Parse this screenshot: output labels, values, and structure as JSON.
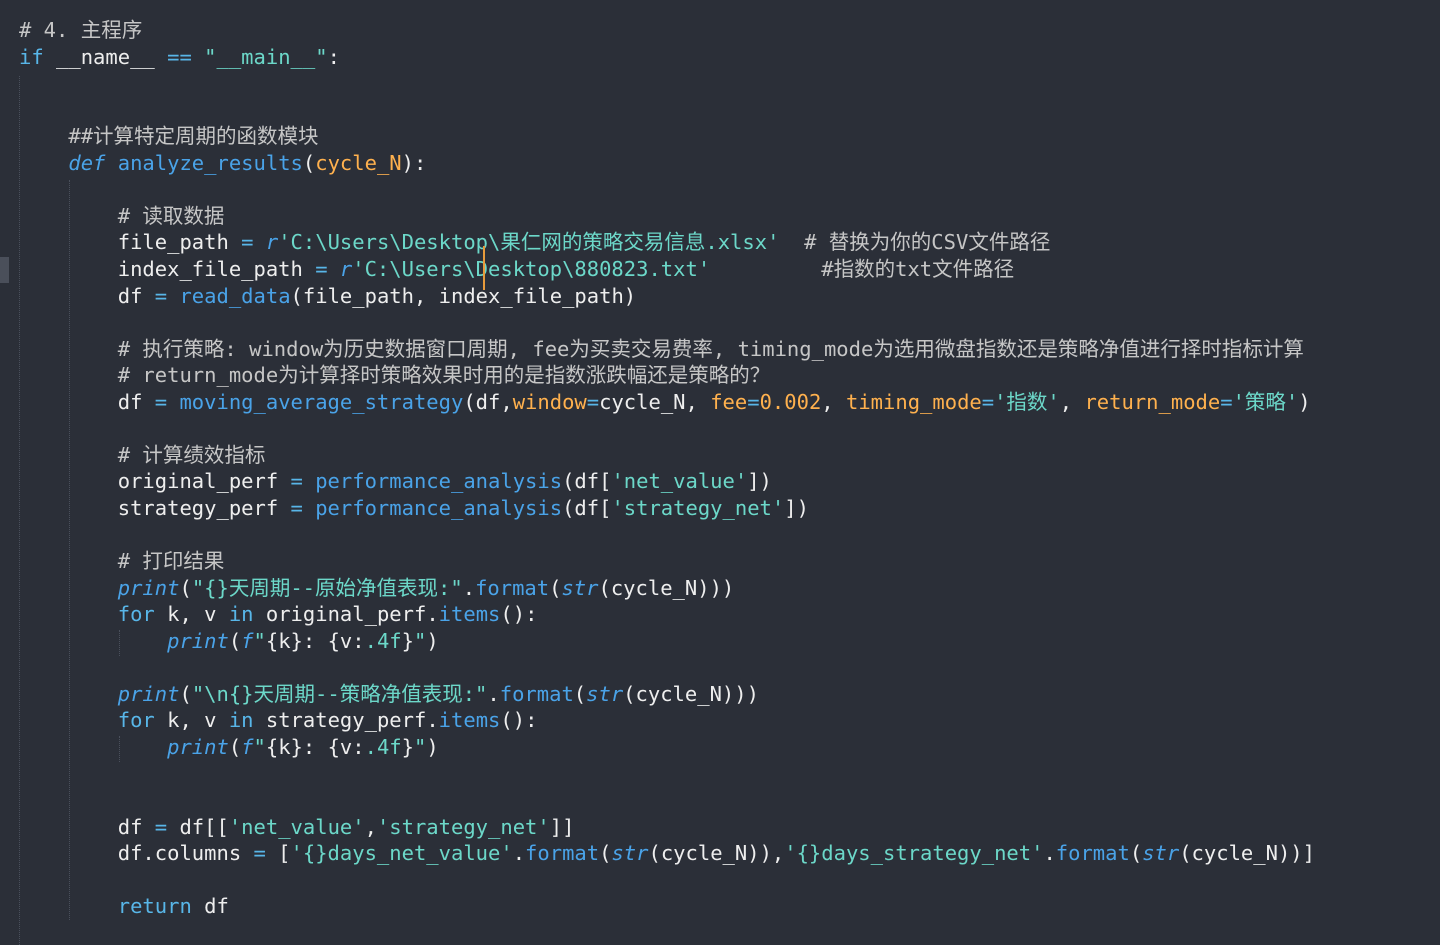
{
  "editor": {
    "language": "python",
    "background": "#2b2f38",
    "colors": {
      "comment": "#c6c6c6",
      "keyword": "#58b6e8",
      "string": "#6cd8c9",
      "function": "#4aa3e8",
      "param": "#ffb14e",
      "text": "#eeeeee",
      "caret": "#e89b3c"
    },
    "lines": [
      [
        [
          "c",
          "# 4. 主程序"
        ]
      ],
      [
        [
          "k",
          "if"
        ],
        [
          "t",
          " __name__ "
        ],
        [
          "o",
          "=="
        ],
        [
          "t",
          " "
        ],
        [
          "s",
          "\"__main__\""
        ],
        [
          "t",
          ":"
        ]
      ],
      [],
      [],
      [
        [
          "t",
          "    "
        ],
        [
          "c",
          "##计算特定周期的函数模块"
        ]
      ],
      [
        [
          "t",
          "    "
        ],
        [
          "i",
          "def"
        ],
        [
          "t",
          " "
        ],
        [
          "f",
          "analyze_results"
        ],
        [
          "t",
          "("
        ],
        [
          "p",
          "cycle_N"
        ],
        [
          "t",
          "):"
        ]
      ],
      [],
      [
        [
          "t",
          "        "
        ],
        [
          "c",
          "# 读取数据"
        ]
      ],
      [
        [
          "t",
          "        file_path "
        ],
        [
          "o",
          "="
        ],
        [
          "t",
          " "
        ],
        [
          "i",
          "r"
        ],
        [
          "s",
          "'C:\\Users\\Desktop\\果仁网的策略交易信息.xlsx'"
        ],
        [
          "t",
          "  "
        ],
        [
          "c",
          "# 替换为你的CSV文件路径"
        ]
      ],
      [
        [
          "t",
          "        index_file_path "
        ],
        [
          "o",
          "="
        ],
        [
          "t",
          " "
        ],
        [
          "i",
          "r"
        ],
        [
          "s",
          "'C:\\Users\\Desktop\\880823.txt'"
        ],
        [
          "t",
          "         "
        ],
        [
          "c",
          "#指数的txt文件路径"
        ]
      ],
      [
        [
          "t",
          "        df "
        ],
        [
          "o",
          "="
        ],
        [
          "t",
          " "
        ],
        [
          "f",
          "read_data"
        ],
        [
          "t",
          "(file_path, index_file_path)"
        ]
      ],
      [],
      [
        [
          "t",
          "        "
        ],
        [
          "c",
          "# 执行策略: window为历史数据窗口周期, fee为买卖交易费率, timing_mode为选用微盘指数还是策略净值进行择时指标计算"
        ]
      ],
      [
        [
          "t",
          "        "
        ],
        [
          "c",
          "# return_mode为计算择时策略效果时用的是指数涨跌幅还是策略的？"
        ]
      ],
      [
        [
          "t",
          "        df "
        ],
        [
          "o",
          "="
        ],
        [
          "t",
          " "
        ],
        [
          "f",
          "moving_average_strategy"
        ],
        [
          "t",
          "(df,"
        ],
        [
          "p",
          "window"
        ],
        [
          "o",
          "="
        ],
        [
          "t",
          "cycle_N, "
        ],
        [
          "p",
          "fee"
        ],
        [
          "o",
          "="
        ],
        [
          "p",
          "0.002"
        ],
        [
          "t",
          ", "
        ],
        [
          "p",
          "timing_mode"
        ],
        [
          "o",
          "="
        ],
        [
          "s",
          "'指数'"
        ],
        [
          "t",
          ", "
        ],
        [
          "p",
          "return_mode"
        ],
        [
          "o",
          "="
        ],
        [
          "s",
          "'策略'"
        ],
        [
          "t",
          ")"
        ]
      ],
      [],
      [
        [
          "t",
          "        "
        ],
        [
          "c",
          "# 计算绩效指标"
        ]
      ],
      [
        [
          "t",
          "        original_perf "
        ],
        [
          "o",
          "="
        ],
        [
          "t",
          " "
        ],
        [
          "f",
          "performance_analysis"
        ],
        [
          "t",
          "(df["
        ],
        [
          "s",
          "'net_value'"
        ],
        [
          "t",
          "])"
        ]
      ],
      [
        [
          "t",
          "        strategy_perf "
        ],
        [
          "o",
          "="
        ],
        [
          "t",
          " "
        ],
        [
          "f",
          "performance_analysis"
        ],
        [
          "t",
          "(df["
        ],
        [
          "s",
          "'strategy_net'"
        ],
        [
          "t",
          "])"
        ]
      ],
      [],
      [
        [
          "t",
          "        "
        ],
        [
          "c",
          "# 打印结果"
        ]
      ],
      [
        [
          "t",
          "        "
        ],
        [
          "i",
          "print"
        ],
        [
          "t",
          "("
        ],
        [
          "s",
          "\"{}天周期--原始净值表现:\""
        ],
        [
          "t",
          "."
        ],
        [
          "f",
          "format"
        ],
        [
          "t",
          "("
        ],
        [
          "i",
          "str"
        ],
        [
          "t",
          "(cycle_N)))"
        ]
      ],
      [
        [
          "t",
          "        "
        ],
        [
          "k",
          "for"
        ],
        [
          "t",
          " k, v "
        ],
        [
          "k",
          "in"
        ],
        [
          "t",
          " original_perf."
        ],
        [
          "f",
          "items"
        ],
        [
          "t",
          "():"
        ]
      ],
      [
        [
          "t",
          "            "
        ],
        [
          "i",
          "print"
        ],
        [
          "t",
          "("
        ],
        [
          "i",
          "f"
        ],
        [
          "s",
          "\""
        ],
        [
          "t",
          "{k}: {v:"
        ],
        [
          "s",
          ".4f"
        ],
        [
          "t",
          "}"
        ],
        [
          "s",
          "\""
        ],
        [
          "t",
          ")"
        ]
      ],
      [],
      [
        [
          "t",
          "        "
        ],
        [
          "i",
          "print"
        ],
        [
          "t",
          "("
        ],
        [
          "s",
          "\"\\n{}天周期--策略净值表现:\""
        ],
        [
          "t",
          "."
        ],
        [
          "f",
          "format"
        ],
        [
          "t",
          "("
        ],
        [
          "i",
          "str"
        ],
        [
          "t",
          "(cycle_N)))"
        ]
      ],
      [
        [
          "t",
          "        "
        ],
        [
          "k",
          "for"
        ],
        [
          "t",
          " k, v "
        ],
        [
          "k",
          "in"
        ],
        [
          "t",
          " strategy_perf."
        ],
        [
          "f",
          "items"
        ],
        [
          "t",
          "():"
        ]
      ],
      [
        [
          "t",
          "            "
        ],
        [
          "i",
          "print"
        ],
        [
          "t",
          "("
        ],
        [
          "i",
          "f"
        ],
        [
          "s",
          "\""
        ],
        [
          "t",
          "{k}: {v:"
        ],
        [
          "s",
          ".4f"
        ],
        [
          "t",
          "}"
        ],
        [
          "s",
          "\""
        ],
        [
          "t",
          ")"
        ]
      ],
      [],
      [],
      [
        [
          "t",
          "        df "
        ],
        [
          "o",
          "="
        ],
        [
          "t",
          " df[["
        ],
        [
          "s",
          "'net_value'"
        ],
        [
          "t",
          ","
        ],
        [
          "s",
          "'strategy_net'"
        ],
        [
          "t",
          "]]"
        ]
      ],
      [
        [
          "t",
          "        df.columns "
        ],
        [
          "o",
          "="
        ],
        [
          "t",
          " ["
        ],
        [
          "s",
          "'{}days_net_value'"
        ],
        [
          "t",
          "."
        ],
        [
          "f",
          "format"
        ],
        [
          "t",
          "("
        ],
        [
          "i",
          "str"
        ],
        [
          "t",
          "(cycle_N)),"
        ],
        [
          "s",
          "'{}days_strategy_net'"
        ],
        [
          "t",
          "."
        ],
        [
          "f",
          "format"
        ],
        [
          "t",
          "("
        ],
        [
          "i",
          "str"
        ],
        [
          "t",
          "(cycle_N))]"
        ]
      ],
      [],
      [
        [
          "t",
          "        "
        ],
        [
          "k",
          "return"
        ],
        [
          "t",
          " df"
        ]
      ]
    ]
  }
}
